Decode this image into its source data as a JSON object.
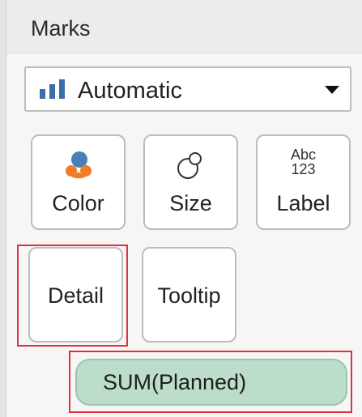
{
  "marks_card": {
    "title": "Marks",
    "mark_type": {
      "selected": "Automatic",
      "icon": "bar-chart-icon"
    },
    "buttons": [
      {
        "label": "Color",
        "icon": "color-icon"
      },
      {
        "label": "Size",
        "icon": "size-icon"
      },
      {
        "label": "Label",
        "icon": "label-abc-icon",
        "icon_text_top": "Abc",
        "icon_text_bottom": "123"
      },
      {
        "label": "Detail",
        "icon": "none"
      },
      {
        "label": "Tooltip",
        "icon": "none"
      }
    ],
    "fields": [
      {
        "label": "SUM(Planned)"
      }
    ],
    "colors": {
      "highlight": "#e0313a",
      "pill_fill": "#bcddc9",
      "bars_icon": "#3a6fa8",
      "color_icon_orange": "#f07d2a",
      "color_icon_blue": "#4a7fb5"
    }
  }
}
